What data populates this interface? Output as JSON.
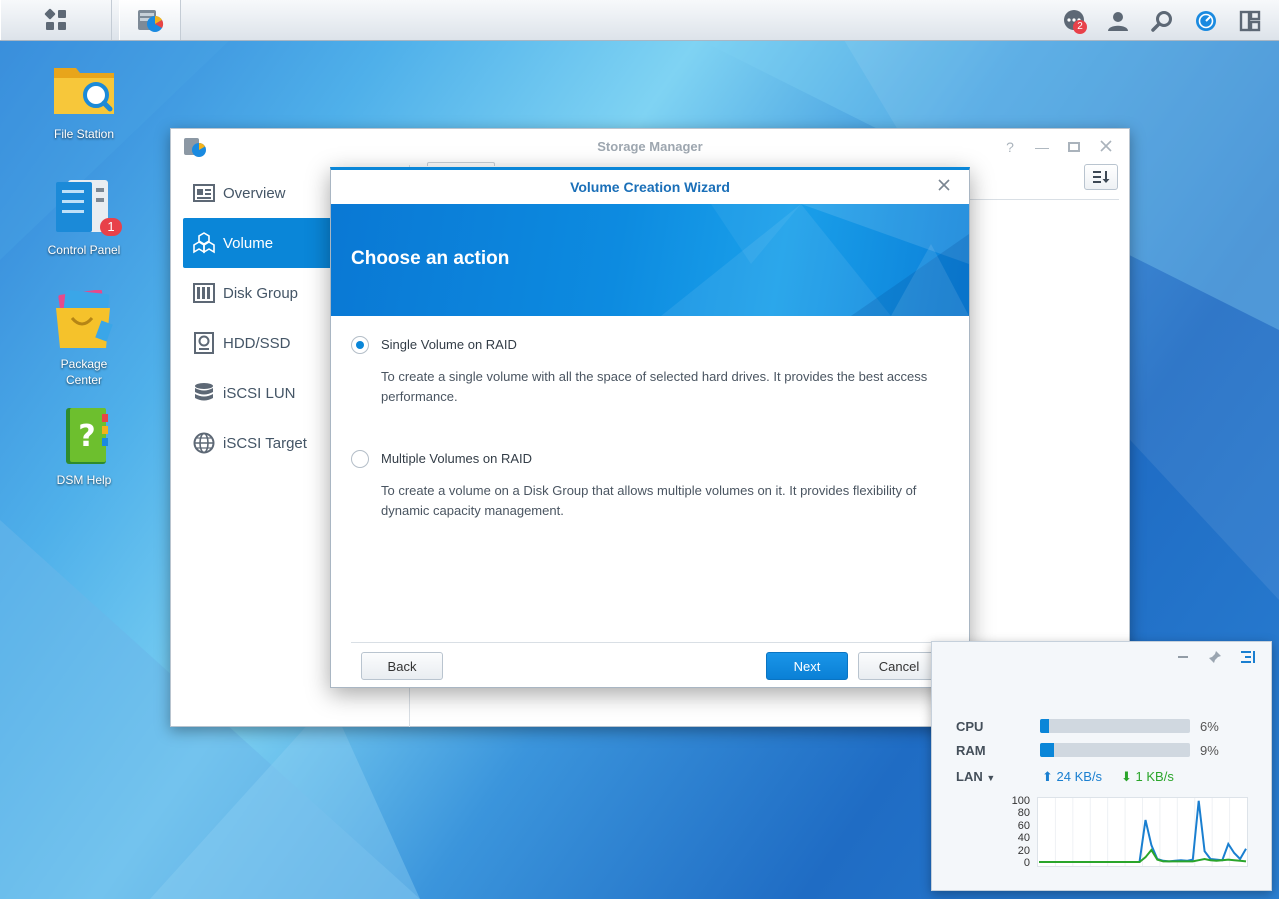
{
  "taskbar": {
    "notification_count": "2"
  },
  "desktop": {
    "icons": [
      {
        "label": "File Station"
      },
      {
        "label": "Control Panel",
        "badge": "1"
      },
      {
        "label": "Package\nCenter"
      },
      {
        "label": "DSM Help"
      }
    ]
  },
  "storage_manager": {
    "title": "Storage Manager",
    "sidebar": [
      {
        "label": "Overview",
        "icon": "overview-icon"
      },
      {
        "label": "Volume",
        "icon": "volume-icon",
        "active": true
      },
      {
        "label": "Disk Group",
        "icon": "disk-group-icon"
      },
      {
        "label": "HDD/SSD",
        "icon": "hdd-icon"
      },
      {
        "label": "iSCSI LUN",
        "icon": "iscsi-lun-icon"
      },
      {
        "label": "iSCSI Target",
        "icon": "iscsi-target-icon"
      }
    ]
  },
  "wizard": {
    "title": "Volume Creation Wizard",
    "heading": "Choose an action",
    "options": [
      {
        "label": "Single Volume on RAID",
        "description": "To create a single volume with all the space of selected hard drives. It provides the best access performance.",
        "selected": true
      },
      {
        "label": "Multiple Volumes on RAID",
        "description": "To create a volume on a Disk Group that allows multiple volumes on it. It provides flexibility of dynamic capacity management.",
        "selected": false
      }
    ],
    "buttons": {
      "back": "Back",
      "next": "Next",
      "cancel": "Cancel"
    }
  },
  "resource_monitor": {
    "rows": [
      {
        "label": "CPU",
        "percent_text": "6%",
        "value": 6
      },
      {
        "label": "RAM",
        "percent_text": "9%",
        "value": 9
      }
    ],
    "lan_label": "LAN",
    "upload": "24 KB/s",
    "download": "1 KB/s",
    "colors": {
      "upload": "#1a7fd0",
      "download": "#2aa52a",
      "bar": "#0a86d8"
    }
  },
  "chart_data": {
    "type": "line",
    "yticks": [
      "100",
      "80",
      "60",
      "40",
      "20",
      "0"
    ],
    "ylim": [
      0,
      100
    ],
    "series": [
      {
        "values": [
          0,
          0,
          0,
          0,
          0,
          0,
          0,
          0,
          0,
          0,
          0,
          0,
          0,
          0,
          0,
          0,
          0,
          0,
          70,
          28,
          5,
          2,
          1,
          2,
          3,
          2,
          4,
          102,
          18,
          5,
          4,
          3,
          30,
          15,
          5,
          22
        ]
      },
      {
        "values": [
          0,
          0,
          0,
          0,
          0,
          0,
          0,
          0,
          0,
          0,
          0,
          0,
          0,
          0,
          0,
          0,
          0,
          0,
          8,
          20,
          4,
          1,
          1,
          1,
          1,
          1,
          1,
          3,
          5,
          3,
          2,
          3,
          4,
          3,
          2,
          1
        ]
      }
    ]
  }
}
